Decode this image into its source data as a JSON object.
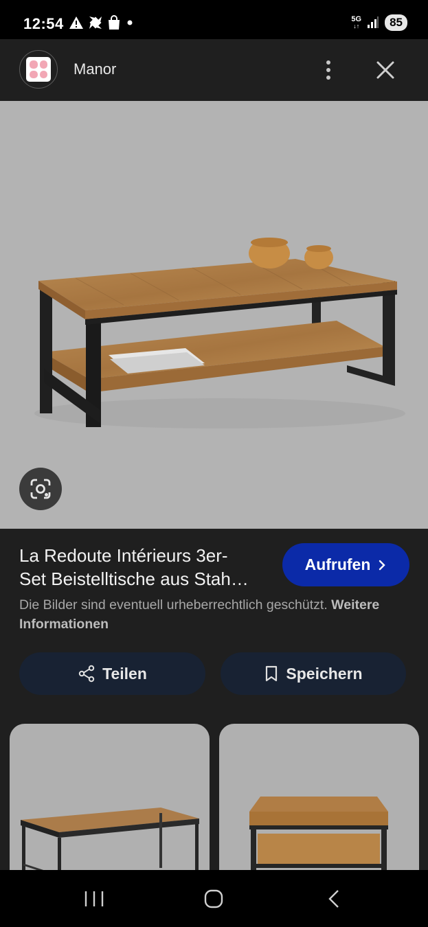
{
  "status_bar": {
    "time": "12:54",
    "network": "5G",
    "battery": "85"
  },
  "header": {
    "site_name": "Manor"
  },
  "result": {
    "title_line1": "La Redoute Intérieurs 3er-",
    "title_line2": "Set Beistelltische aus Stah…",
    "visit_label": "Aufrufen",
    "copyright_text": "Die Bilder sind eventuell urheberrechtlich geschützt.",
    "more_info_link": "Weitere Informationen"
  },
  "actions": {
    "share_label": "Teilen",
    "save_label": "Speichern"
  },
  "colors": {
    "accent": "#0b2aa8",
    "background": "#1f1f1f",
    "action_bg": "#182233"
  },
  "icons": [
    "warning-icon",
    "pinwheel-icon",
    "shopping-bag-icon",
    "dot-icon",
    "signal-icon",
    "more-vert-icon",
    "close-icon",
    "google-lens-icon",
    "chevron-right-icon",
    "share-icon",
    "bookmark-icon",
    "recent-apps-icon",
    "home-icon",
    "back-icon"
  ]
}
